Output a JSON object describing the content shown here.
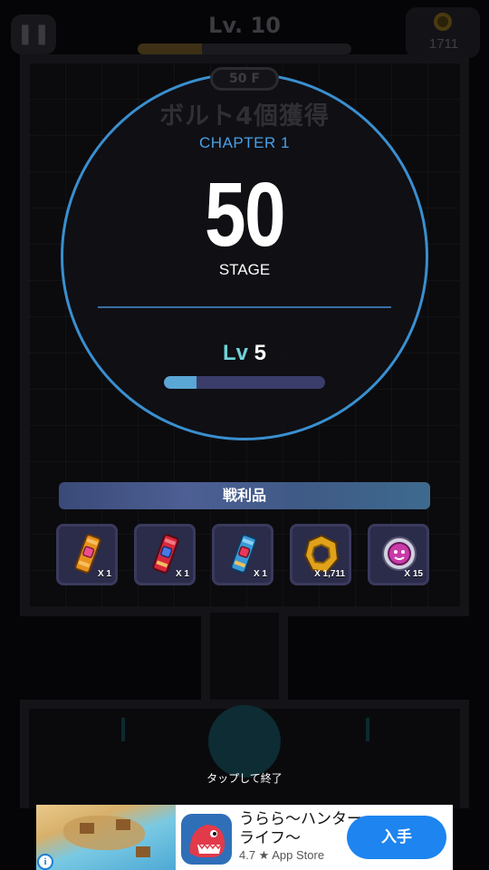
{
  "hud": {
    "level": "Lv. 10",
    "xp_progress": 0.3,
    "coins": "1711"
  },
  "background": {
    "floor": "50 F",
    "mission": "ボルト4個獲得"
  },
  "result": {
    "chapter": "CHAPTER 1",
    "stage_number": "50",
    "stage_label": "STAGE",
    "level_prefix": "Lv",
    "level_value": "5",
    "level_progress": 0.2
  },
  "loot": {
    "title": "戦利品",
    "items": [
      {
        "icon": "orange-gem-bolt-icon",
        "qty": "X 1"
      },
      {
        "icon": "red-gem-bolt-icon",
        "qty": "X 1"
      },
      {
        "icon": "blue-gem-bolt-icon",
        "qty": "X 1"
      },
      {
        "icon": "gold-nut-coin-icon",
        "qty": "X 1,711"
      },
      {
        "icon": "pink-token-icon",
        "qty": "X 15"
      }
    ]
  },
  "tap_hint": "タップして終了",
  "ad": {
    "title": "うらら〜ハンターライフ〜",
    "rating": "4.7 ★ App Store",
    "button": "入手",
    "info": "i"
  },
  "colors": {
    "circle_border": "#3a8fcf",
    "chapter": "#4aa0e6",
    "level_prefix": "#6fd2d8",
    "progress_fill": "#5aa6d4",
    "ad_button": "#1d84f0"
  }
}
